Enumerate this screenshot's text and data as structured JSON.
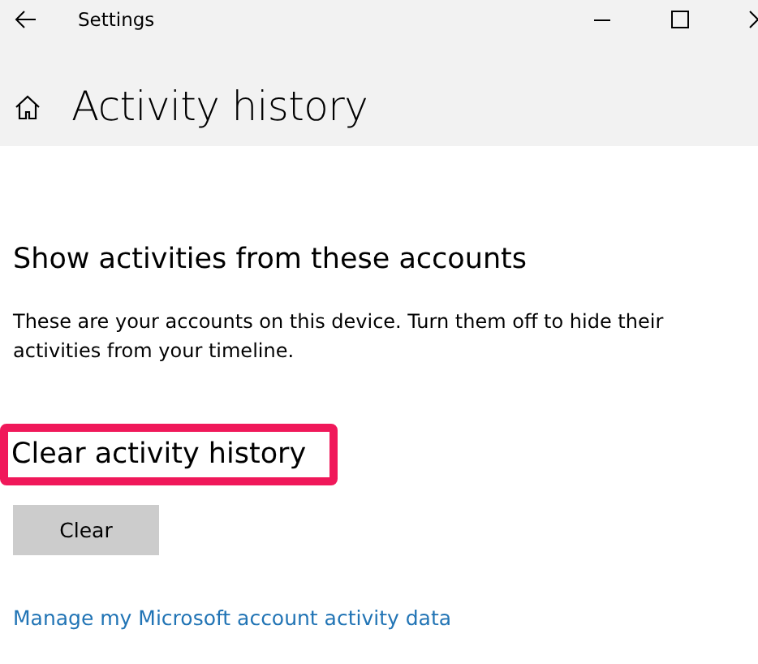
{
  "window": {
    "title": "Settings"
  },
  "page": {
    "title": "Activity history"
  },
  "sections": [
    {
      "heading": "Show activities from these accounts",
      "highlighted": false,
      "description": "These are your accounts on this device. Turn them off to hide their activities from your timeline."
    },
    {
      "heading": "Clear activity history",
      "highlighted": true
    }
  ],
  "buttons": [
    {
      "label": "Clear"
    }
  ],
  "link": {
    "label": "Manage my Microsoft account activity data"
  }
}
